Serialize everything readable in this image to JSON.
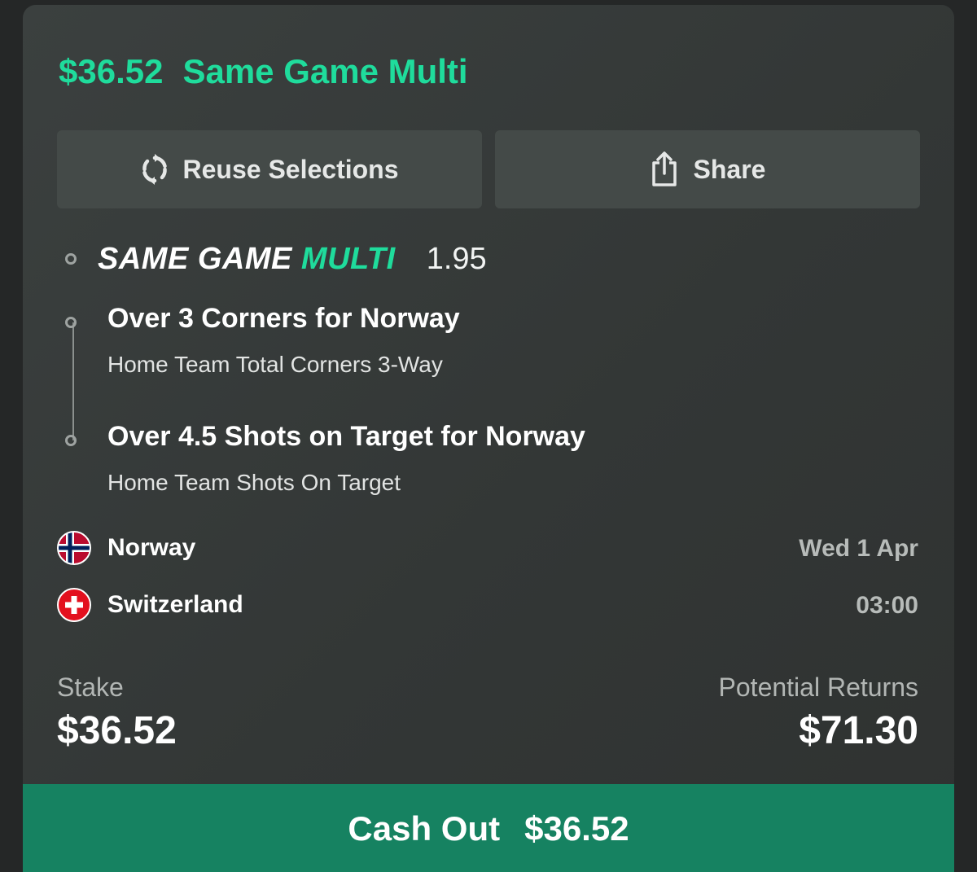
{
  "bet": {
    "amount": "$36.52",
    "type": "Same Game Multi"
  },
  "actions": {
    "reuse_label": "Reuse Selections",
    "share_label": "Share"
  },
  "multi": {
    "title_part1": "SAME GAME",
    "title_part2": "MULTI",
    "odds": "1.95"
  },
  "legs": [
    {
      "title": "Over 3 Corners for Norway",
      "market": "Home Team Total Corners 3-Way"
    },
    {
      "title": "Over 4.5 Shots on Target for Norway",
      "market": "Home Team Shots On Target"
    }
  ],
  "match": {
    "home": "Norway",
    "away": "Switzerland",
    "date": "Wed 1 Apr",
    "time": "03:00"
  },
  "summary": {
    "stake_label": "Stake",
    "stake_value": "$36.52",
    "returns_label": "Potential Returns",
    "returns_value": "$71.30"
  },
  "cashout": {
    "label": "Cash Out",
    "value": "$36.52"
  },
  "icons": {
    "reuse": "refresh-icon",
    "share": "share-icon",
    "home_flag": "norway-flag-icon",
    "away_flag": "switzerland-flag-icon"
  },
  "colors": {
    "accent": "#1fdc9c",
    "cashout_bg": "#168261",
    "card_bg": "#373b3a"
  }
}
